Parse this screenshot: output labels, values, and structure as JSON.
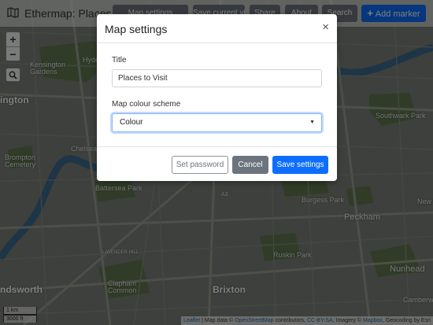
{
  "app": {
    "title": "Ethermap: Places to Visit"
  },
  "toolbar": {
    "map_settings": "Map settings",
    "save_view": "Save current view",
    "share": "Share",
    "about": "About",
    "search": "Search",
    "add_marker": "Add marker"
  },
  "map": {
    "zoom_in": "+",
    "zoom_out": "−",
    "scale_km": "1 km",
    "scale_ft": "3000 ft",
    "labels": {
      "kensington_gardens": "Kensington Gardens",
      "ington": "ington",
      "chelsea": "Chelsea",
      "brompton_cemetery": "Brompton Cemetery",
      "battersea_park": "Battersea Park",
      "southwark_park": "Southwark Park",
      "peckham": "Peckham",
      "burgess_park": "Burgess Park",
      "ruskin_park": "Ruskin Park",
      "brixton": "Brixton",
      "clapham_common": "Clapham Common",
      "nunhead": "Nunhead",
      "ndsworth": "ndsworth",
      "lavender_hill": "LAVENDER HILL",
      "camberwell": "Camberwell",
      "new_cross": "New Cross",
      "hyde": "Hyde",
      "a3": "A3"
    }
  },
  "attribution": {
    "leaflet": "Leaflet",
    "map_data": " | Map data © ",
    "osm": "OpenStreetMap",
    "contributors": " contributors, ",
    "license": "CC-BY-SA",
    "imagery": ", Imagery © ",
    "mapbox": "Mapbox",
    "geocoding": ", Geocoding by Esri"
  },
  "modal": {
    "title": "Map settings",
    "close": "×",
    "title_label": "Title",
    "title_value": "Places to Visit",
    "colour_label": "Map colour scheme",
    "colour_value": "Colour",
    "set_password": "Set password",
    "cancel": "Cancel",
    "save": "Save settings"
  },
  "colors": {
    "primary": "#0d6efd",
    "secondary": "#6c757d",
    "river": "#3b6e93",
    "park": "#5f7a4f"
  }
}
